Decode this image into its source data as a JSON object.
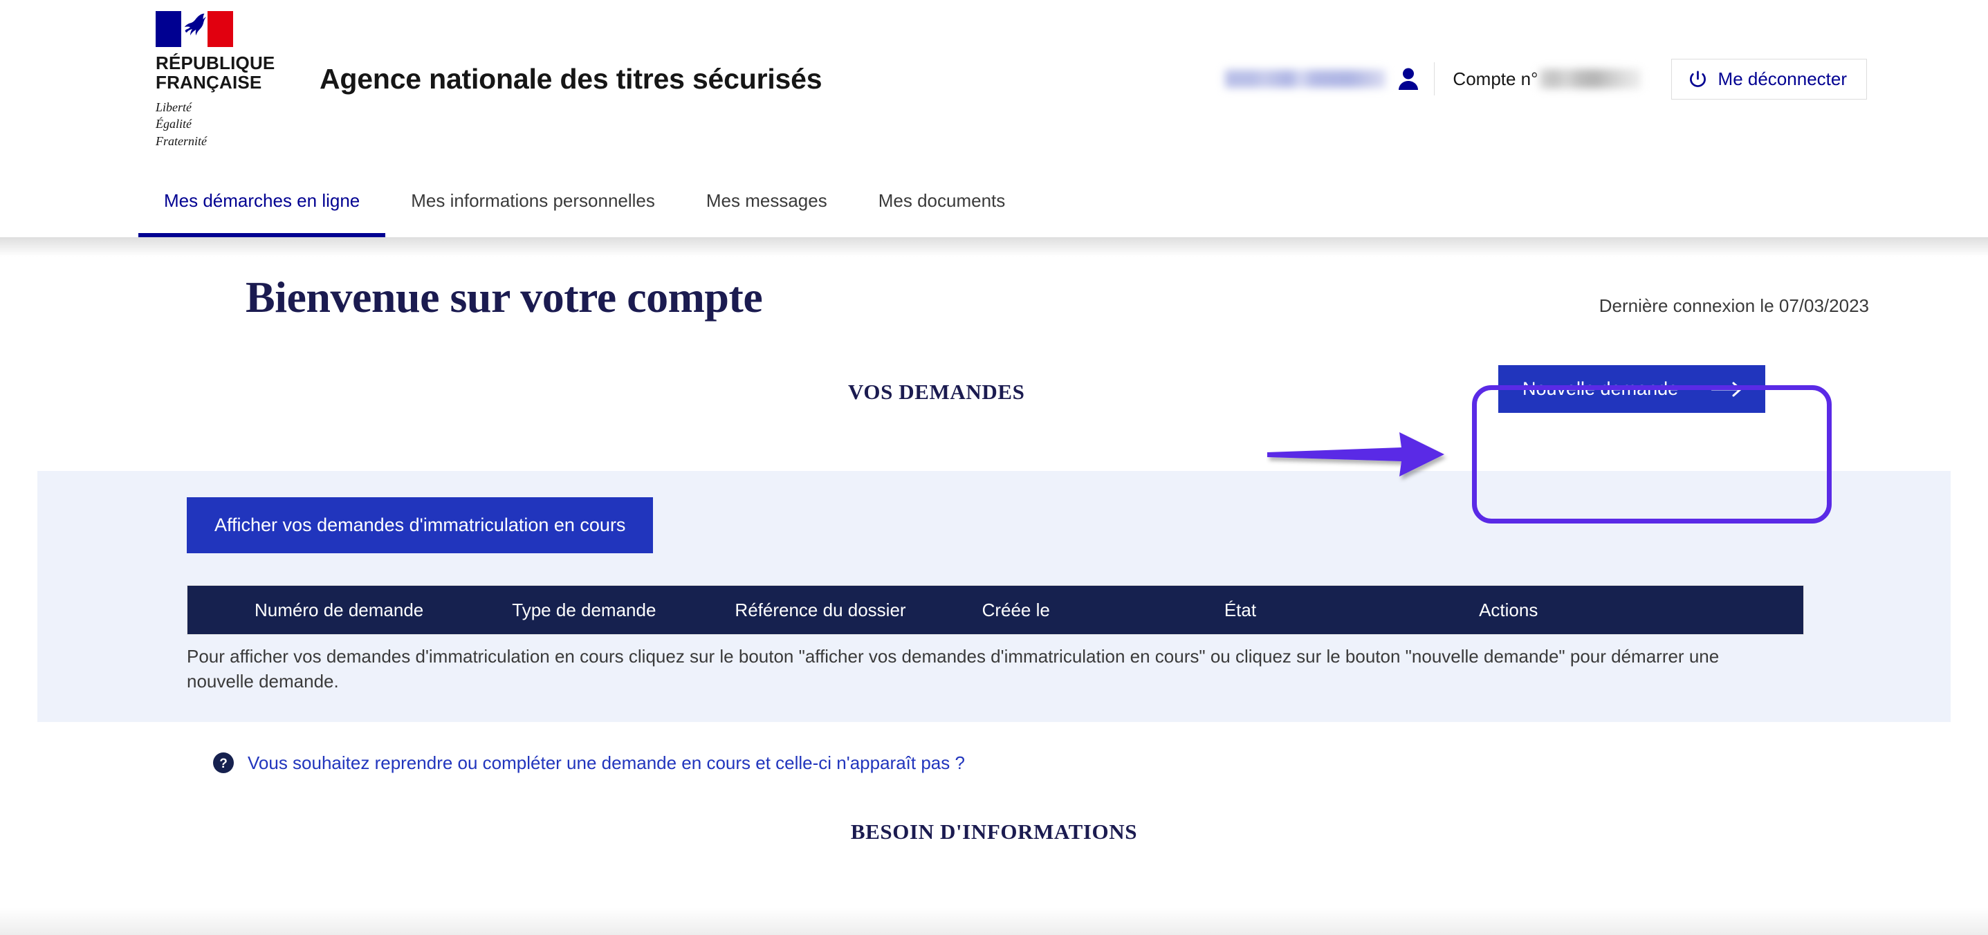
{
  "header": {
    "republic_line1": "RÉPUBLIQUE",
    "republic_line2": "FRANÇAISE",
    "devise_1": "Liberté",
    "devise_2": "Égalité",
    "devise_3": "Fraternité",
    "site_title": "Agence nationale des titres sécurisés",
    "account_label": "Compte n°",
    "logout_label": "Me déconnecter",
    "user_icon": "user-icon",
    "power_icon": "power-icon",
    "flag_colors": {
      "blue": "#000091",
      "white": "#FFFFFF",
      "red": "#E1000F"
    }
  },
  "nav": {
    "tabs": [
      {
        "label": "Mes démarches en ligne",
        "active": true
      },
      {
        "label": "Mes informations personnelles",
        "active": false
      },
      {
        "label": "Mes messages",
        "active": false
      },
      {
        "label": "Mes documents",
        "active": false
      }
    ],
    "active_color": "#000091"
  },
  "main": {
    "welcome_title": "Bienvenue sur votre compte",
    "last_login": "Dernière connexion le 07/03/2023",
    "section_title": "VOS DEMANDES",
    "new_request_button": "Nouvelle demande",
    "new_request_icon": "arrow-right-icon",
    "show_requests_button": "Afficher vos demandes d'immatriculation en cours",
    "table": {
      "columns": [
        "Numéro de demande",
        "Type de demande",
        "Référence du dossier",
        "Créée le",
        "État",
        "Actions"
      ],
      "rows": [],
      "empty_note": "Pour afficher vos demandes d'immatriculation en cours cliquez sur le bouton \"afficher vos demandes d'immatriculation en cours\" ou cliquez sur le bouton \"nouvelle demande\" pour démarrer une nouvelle demande."
    },
    "help_icon": "question-mark-icon",
    "help_link": "Vous souhaitez reprendre ou compléter une demande en cours et celle-ci n'apparaît pas ?",
    "info_section_title": "BESOIN D'INFORMATIONS"
  },
  "annotations": {
    "highlight_color": "#5A2AE6",
    "arrow_color": "#5A2AE6",
    "highlight_target": "new-request-button"
  },
  "colors": {
    "primary_blue": "#2135BD",
    "navy": "#16214F",
    "marianne_blue": "#000091",
    "panel_bg": "#EEF2FB",
    "heading_navy": "#1B1B50"
  }
}
